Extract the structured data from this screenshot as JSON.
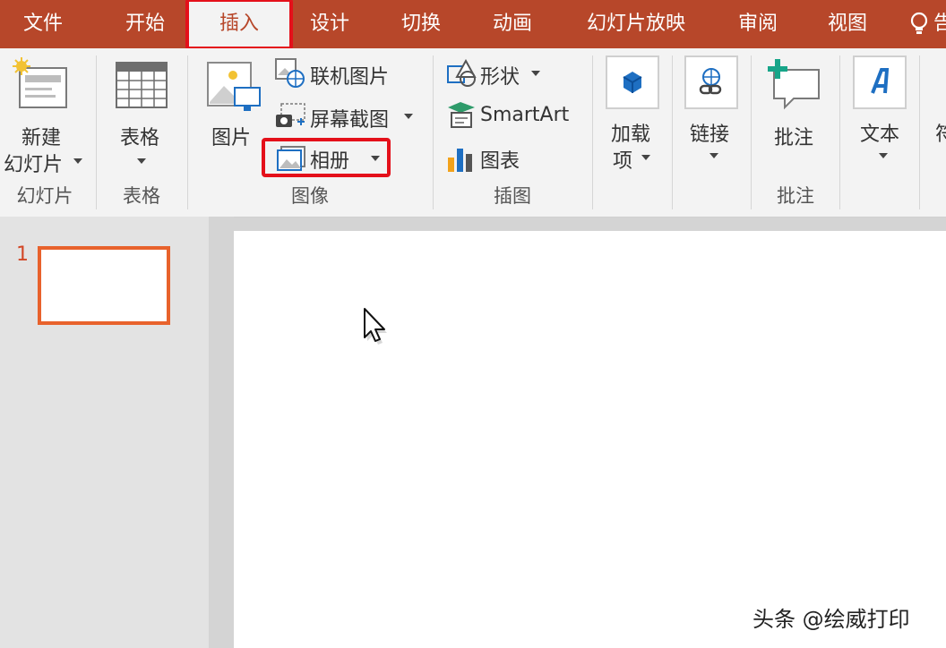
{
  "tabs": [
    {
      "label": "文件"
    },
    {
      "label": "开始"
    },
    {
      "label": "插入"
    },
    {
      "label": "设计"
    },
    {
      "label": "切换"
    },
    {
      "label": "动画"
    },
    {
      "label": "幻灯片放映"
    },
    {
      "label": "审阅"
    },
    {
      "label": "视图"
    }
  ],
  "tell_me": {
    "label": "告"
  },
  "ribbon": {
    "slides_group": {
      "new_slide_line1": "新建",
      "new_slide_line2": "幻灯片",
      "label": "幻灯片"
    },
    "tables_group": {
      "table": "表格",
      "label": "表格"
    },
    "images_group": {
      "pictures": "图片",
      "online_pictures": "联机图片",
      "screenshot": "屏幕截图",
      "photo_album": "相册",
      "label": "图像"
    },
    "illustrations_group": {
      "shapes": "形状",
      "smartart": "SmartArt",
      "chart": "图表",
      "label": "插图"
    },
    "addins": {
      "line1": "加载",
      "line2": "项"
    },
    "links": {
      "label": "链接"
    },
    "comments_group": {
      "comment": "批注",
      "label": "批注"
    },
    "text": {
      "label": "文本"
    },
    "symbols": {
      "label": "符"
    }
  },
  "slides": {
    "number": "1"
  },
  "watermark": "头条 @绘威打印",
  "colors": {
    "accent": "#b7472a",
    "highlight": "#e4101a",
    "thumb_border": "#e8622c"
  }
}
